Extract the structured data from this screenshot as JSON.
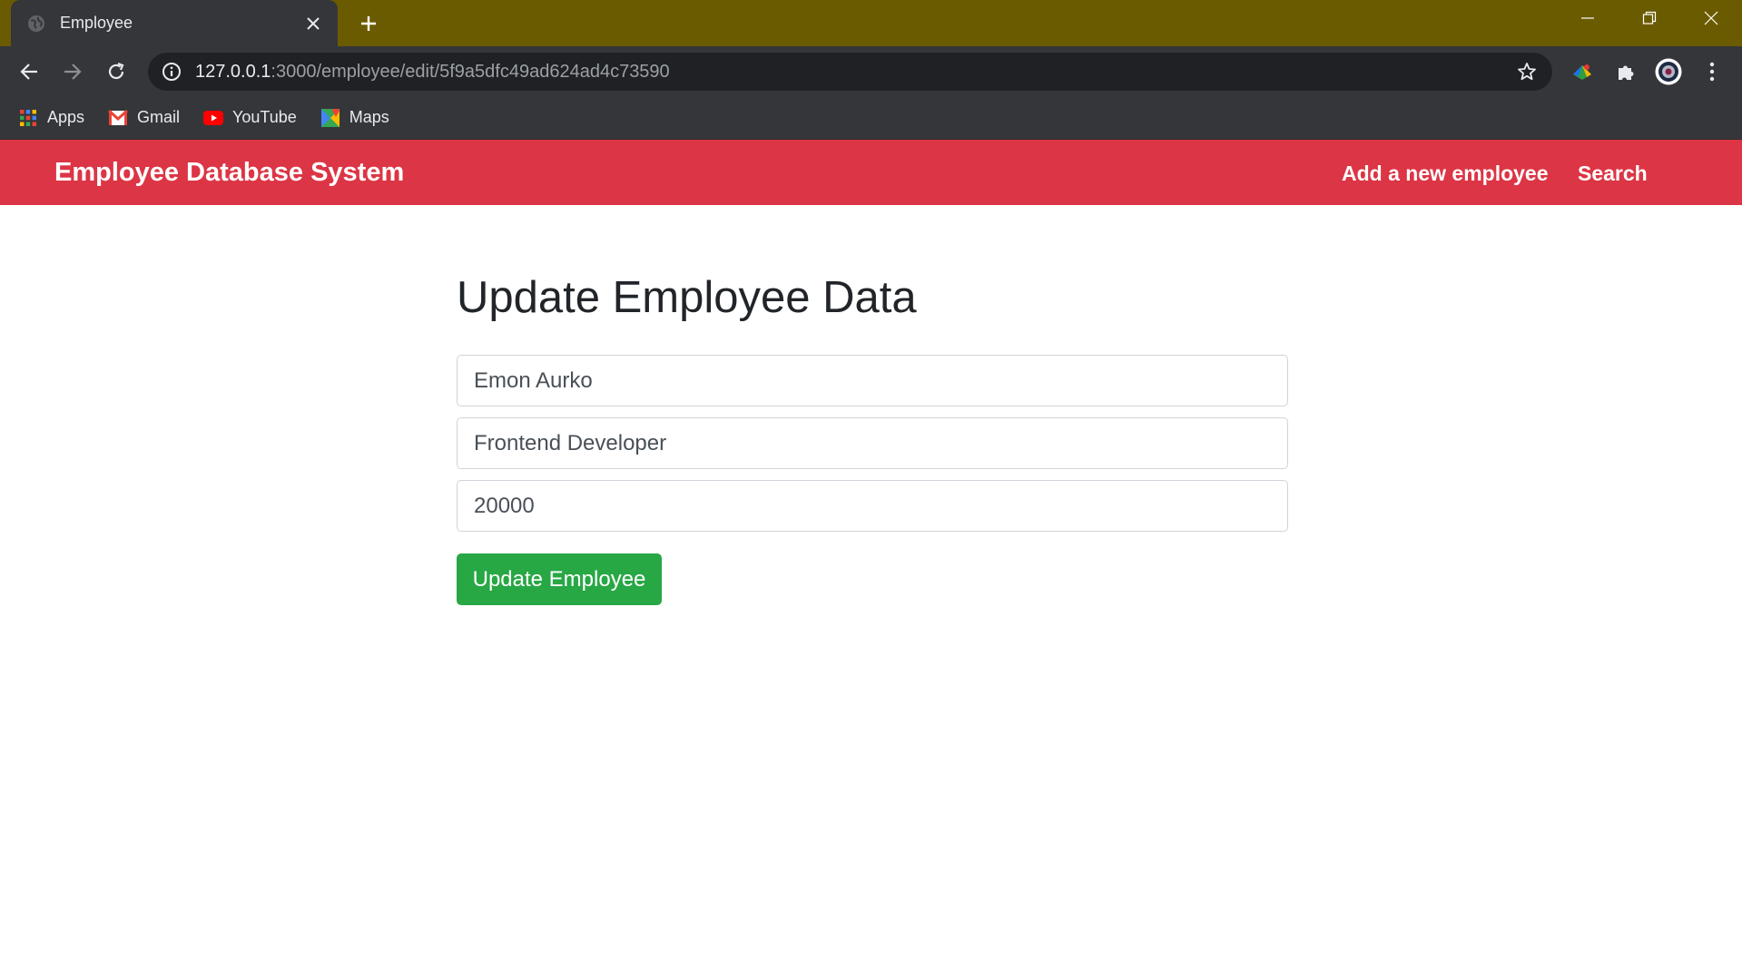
{
  "browser": {
    "tab_title": "Employee",
    "url_host": "127.0.0.1",
    "url_rest": ":3000/employee/edit/5f9a5dfc49ad624ad4c73590",
    "bookmarks": [
      {
        "label": "Apps",
        "icon": "apps-grid-icon"
      },
      {
        "label": "Gmail",
        "icon": "gmail-icon"
      },
      {
        "label": "YouTube",
        "icon": "youtube-icon"
      },
      {
        "label": "Maps",
        "icon": "maps-icon"
      }
    ],
    "colors": {
      "titlebar": "#6b5b00",
      "chrome": "#35363a",
      "omnibox": "#202124"
    }
  },
  "navbar": {
    "brand": "Employee Database System",
    "links": [
      "Add a new employee",
      "Search"
    ],
    "color": "#dc3545"
  },
  "main": {
    "heading": "Update Employee Data",
    "fields": {
      "name": "Emon Aurko",
      "designation": "Frontend Developer",
      "salary": "20000"
    },
    "submit_label": "Update Employee",
    "submit_color": "#28a745"
  }
}
